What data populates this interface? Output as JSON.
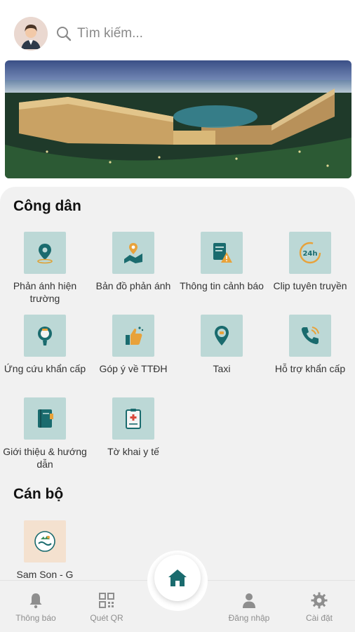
{
  "search": {
    "placeholder": "Tìm kiếm..."
  },
  "banner": {
    "alt": "Resort aerial photo"
  },
  "sections": {
    "citizen": {
      "title": "Công dân",
      "items": [
        {
          "label": "Phản ánh hiện trường",
          "icon": "location-pin-icon"
        },
        {
          "label": "Bản đồ phản ánh",
          "icon": "map-pin-icon"
        },
        {
          "label": "Thông tin cảnh báo",
          "icon": "warning-document-icon"
        },
        {
          "label": "Clip tuyên truyền",
          "icon": "24h-clock-icon"
        },
        {
          "label": "Ứng cứu khẩn cấp",
          "icon": "emergency-bulb-icon"
        },
        {
          "label": "Góp ý về TTĐH",
          "icon": "thumbs-up-icon"
        },
        {
          "label": "Taxi",
          "icon": "taxi-pin-icon"
        },
        {
          "label": "Hỗ trợ khẩn cấp",
          "icon": "phone-call-icon"
        },
        {
          "label": "Giới thiệu & hướng dẫn",
          "icon": "book-icon"
        },
        {
          "label": "Tờ khai y tế",
          "icon": "medical-form-icon"
        }
      ]
    },
    "staff": {
      "title": "Cán bộ",
      "items": [
        {
          "label": "Sam Son - G",
          "icon": "sam-son-logo-icon"
        }
      ]
    }
  },
  "tabbar": {
    "notifications": "Thông báo",
    "scan_qr": "Quét QR",
    "login": "Đăng nhập",
    "settings": "Cài đặt"
  },
  "colors": {
    "accent": "#1a6b6e",
    "tile_bg": "#bcd8d6",
    "panel_bg": "#f1f1f1"
  }
}
